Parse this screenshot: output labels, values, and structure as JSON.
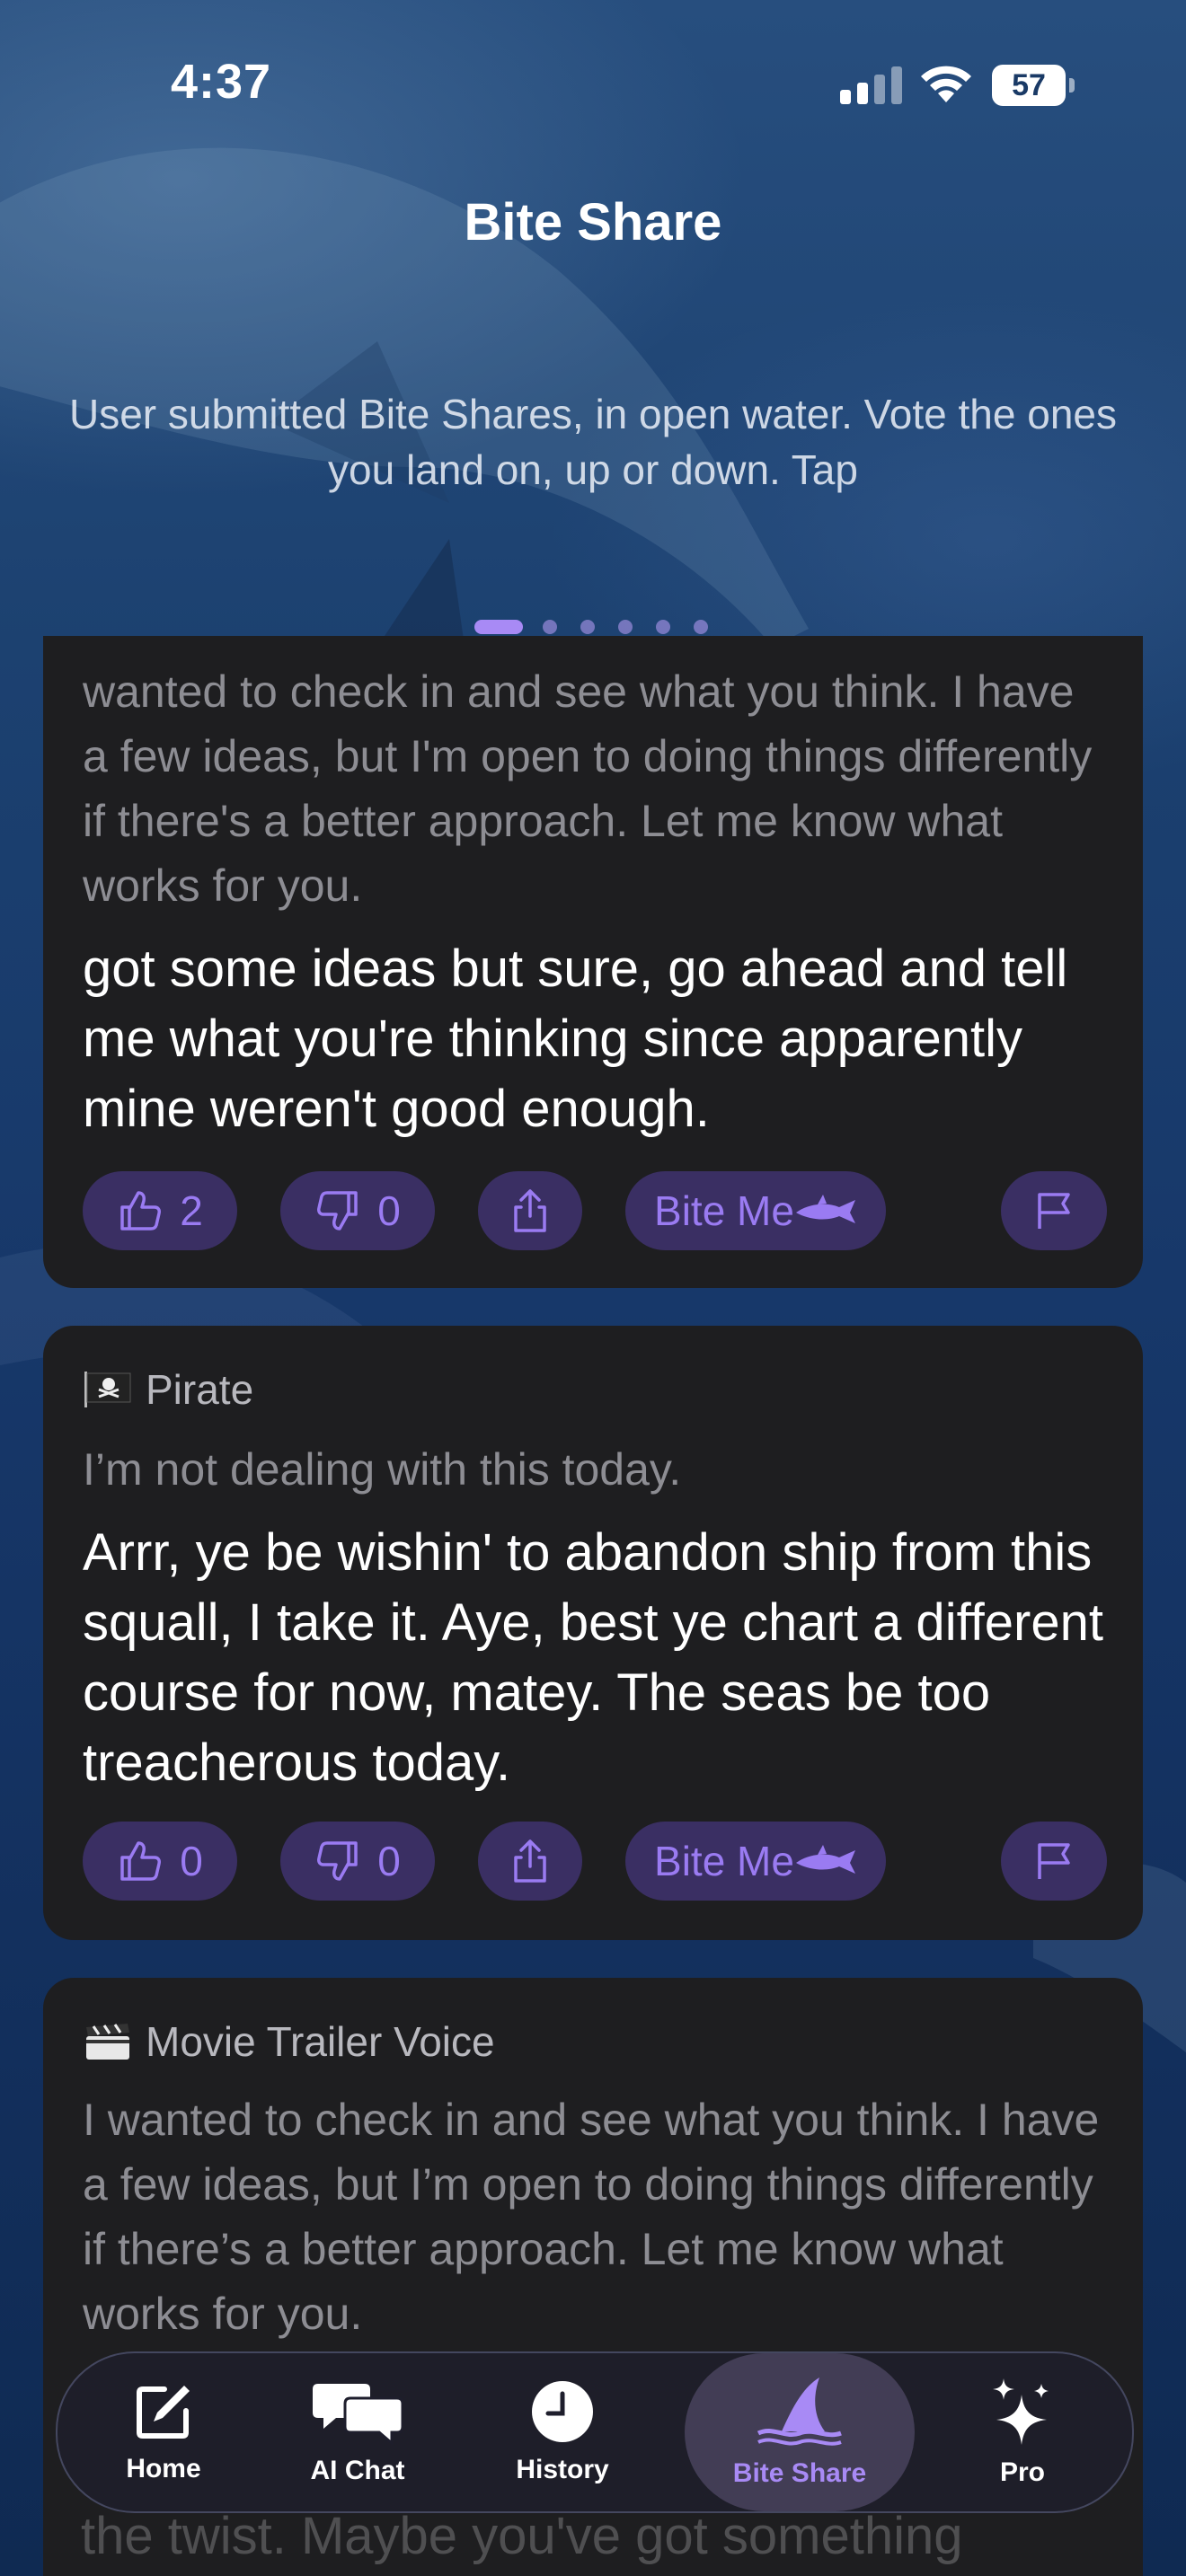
{
  "status_bar": {
    "time": "4:37",
    "battery": "57"
  },
  "header": {
    "title": "Bite Share",
    "subtitle": "User submitted Bite Shares, in open water. Vote the ones you land on, up or down. Tap"
  },
  "pager": {
    "count": 6,
    "active_index": 0
  },
  "cards": [
    {
      "tag": "",
      "original": "wanted to check in and see what you think. I have a few ideas, but I'm open to doing things differently if there's a better approach. Let me know what works for you.",
      "reply": "got some ideas but sure, go ahead and tell me what you're thinking since apparently mine weren't good enough.",
      "upvotes": "2",
      "downvotes": "0",
      "bite_label": "Bite Me"
    },
    {
      "tag": "Pirate",
      "original": "I’m not dealing with this today.",
      "reply": "Arrr, ye be wishin' to abandon ship from this squall, I take it. Aye, best ye chart a different course for now, matey. The seas be too treacherous today.",
      "upvotes": "0",
      "downvotes": "0",
      "bite_label": "Bite Me"
    },
    {
      "tag": "Movie Trailer Voice",
      "original": "I wanted to check in and see what you think. I have a few ideas, but I’m open to doing things differently if there’s a better approach. Let me know what works for you.",
      "reply_partial": "the twist. Maybe you've got something"
    }
  ],
  "tabbar": {
    "tabs": [
      {
        "label": "Home",
        "icon": "compose-icon"
      },
      {
        "label": "AI Chat",
        "icon": "chat-bubbles-icon"
      },
      {
        "label": "History",
        "icon": "clock-icon"
      },
      {
        "label": "Bite Share",
        "icon": "shark-fin-icon",
        "active": true
      },
      {
        "label": "Pro",
        "icon": "sparkles-icon"
      }
    ]
  },
  "colors": {
    "accent": "#a88af5",
    "pill_bg": "#3a2f63",
    "card_bg": "#1e1e20"
  }
}
